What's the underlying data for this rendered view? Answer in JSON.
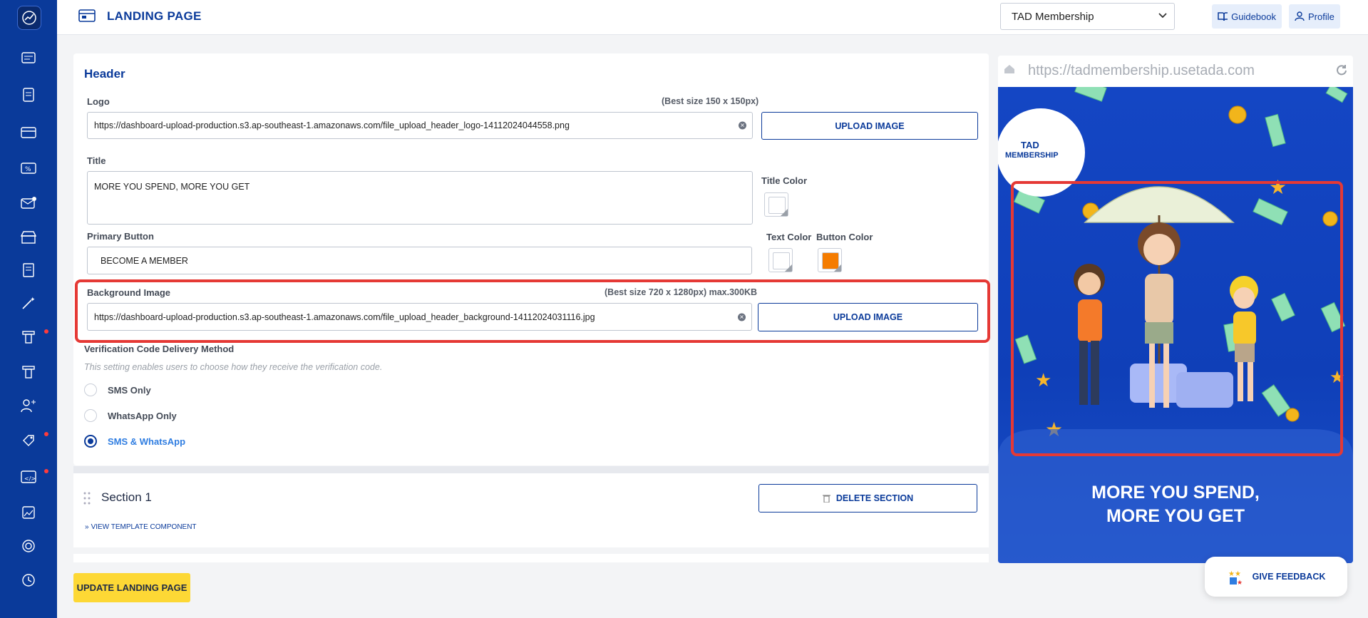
{
  "header": {
    "page_title": "LANDING PAGE",
    "workspace_select": "TAD Membership",
    "guidebook_label": "Guidebook",
    "profile_label": "Profile"
  },
  "sidebar": {
    "icons": [
      "dashboard-icon",
      "report-icon",
      "card-icon",
      "voucher-icon",
      "mail-icon",
      "store-icon",
      "receipt-icon",
      "magic-wand-icon",
      "program-icon",
      "program-alt-icon",
      "user-group-icon",
      "tag-icon",
      "web-code-icon",
      "image-file-icon",
      "target-icon",
      "history-icon"
    ]
  },
  "form": {
    "section_title": "Header",
    "logo_label": "Logo",
    "logo_hint": "(Best size 150 x 150px)",
    "logo_url": "https://dashboard-upload-production.s3.ap-southeast-1.amazonaws.com/file_upload_header_logo-14112024044558.png",
    "upload_image_label": "UPLOAD IMAGE",
    "title_label": "Title",
    "title_value": "MORE YOU SPEND, MORE YOU GET",
    "title_color_label": "Title Color",
    "primary_button_label": "Primary Button",
    "primary_button_value": "BECOME A MEMBER",
    "text_color_label": "Text Color",
    "button_color_label": "Button Color",
    "button_color": "#f57c00",
    "bg_image_label": "Background Image",
    "bg_image_hint": "(Best size 720 x 1280px) max.300KB",
    "bg_image_url": "https://dashboard-upload-production.s3.ap-southeast-1.amazonaws.com/file_upload_header_background-14112024031116.jpg",
    "verification_label": "Verification Code Delivery Method",
    "verification_hint": "This setting enables users to choose how they receive the verification code.",
    "options": [
      {
        "label": "SMS Only",
        "checked": false
      },
      {
        "label": "WhatsApp Only",
        "checked": false
      },
      {
        "label": "SMS & WhatsApp",
        "checked": true
      }
    ]
  },
  "section1": {
    "title": "Section 1",
    "delete_label": "DELETE SECTION",
    "view_template_label": "VIEW TEMPLATE COMPONENT"
  },
  "footer": {
    "update_label": "UPDATE LANDING PAGE"
  },
  "preview": {
    "url": "https://tadmembership.usetada.com",
    "logo_text_line1": "TAD",
    "logo_text_line2": "MEMBERSHIP",
    "headline_line1": "MORE YOU SPEND,",
    "headline_line2": "MORE YOU GET"
  },
  "feedback": {
    "label": "GIVE FEEDBACK"
  },
  "colors": {
    "brand": "#0a3a9a",
    "highlight": "#e53935",
    "update_button": "#fdd835"
  }
}
